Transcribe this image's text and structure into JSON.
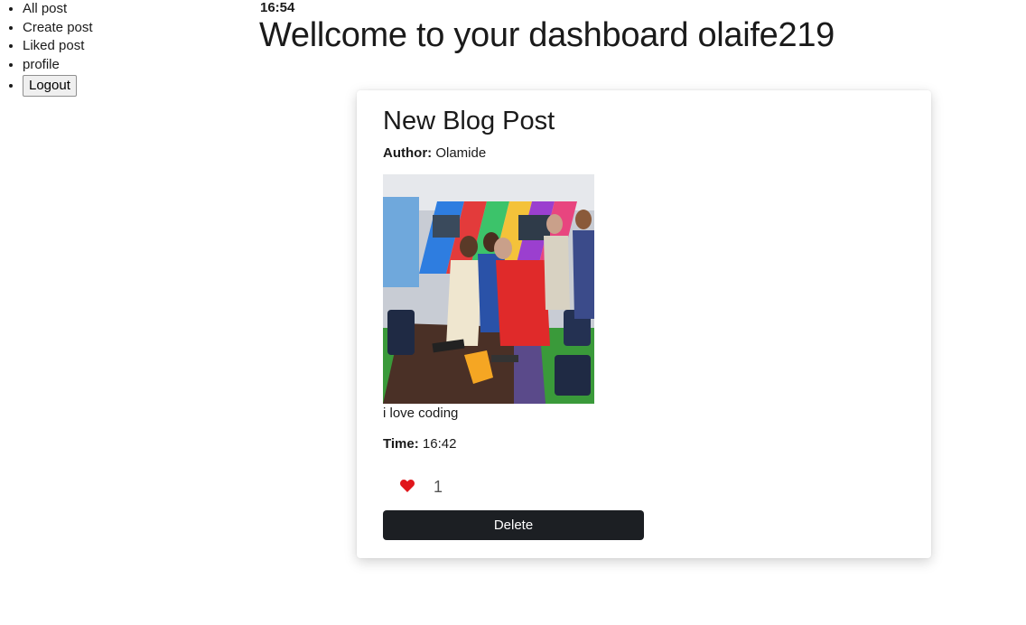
{
  "nav": {
    "items": [
      {
        "label": "All post"
      },
      {
        "label": "Create post"
      },
      {
        "label": "Liked post"
      },
      {
        "label": "profile"
      }
    ],
    "logout_label": "Logout"
  },
  "header": {
    "clock": "16:54",
    "welcome": "Wellcome to your dashboard olaife219"
  },
  "post": {
    "title": "New Blog Post",
    "author_label": "Author:",
    "author": "Olamide",
    "image_icon": "group-photo",
    "body": "i love coding",
    "time_label": "Time:",
    "time": "16:42",
    "like_icon": "heart-icon",
    "like_color": "#e0161b",
    "likes": "1",
    "delete_label": "Delete",
    "delete_color": "#1c1f23"
  }
}
